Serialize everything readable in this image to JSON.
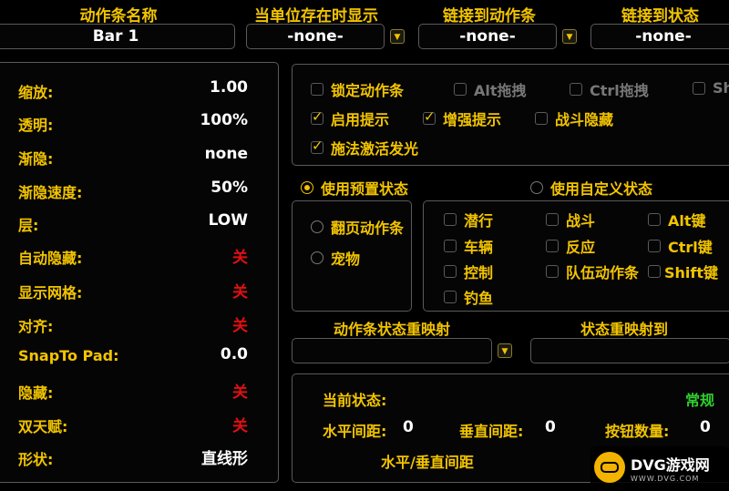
{
  "top": {
    "headers": {
      "bar_name": "动作条名称",
      "show_when_unit_exists": "当单位存在时显示",
      "link_to_bar": "链接到动作条",
      "link_to_state": "链接到状态"
    },
    "bar_name_value": "Bar 1",
    "show_when_unit_value": "-none-",
    "link_to_bar_value": "-none-",
    "link_to_state_value": "-none-"
  },
  "settings": [
    {
      "label": "缩放:",
      "value": "1.00",
      "color": "#ffffff"
    },
    {
      "label": "透明:",
      "value": "100%",
      "color": "#ffffff"
    },
    {
      "label": "渐隐:",
      "value": "none",
      "color": "#ffffff"
    },
    {
      "label": "渐隐速度:",
      "value": "50%",
      "color": "#ffffff"
    },
    {
      "label": "层:",
      "value": "LOW",
      "color": "#ffffff"
    },
    {
      "label": "自动隐藏:",
      "value": "关",
      "color": "#e01010"
    },
    {
      "label": "显示网格:",
      "value": "关",
      "color": "#e01010"
    },
    {
      "label": "对齐:",
      "value": "关",
      "color": "#e01010"
    },
    {
      "label": "SnapTo Pad:",
      "value": "0.0",
      "color": "#ffffff"
    },
    {
      "label": "隐藏:",
      "value": "关",
      "color": "#e01010"
    },
    {
      "label": "双天赋:",
      "value": "关",
      "color": "#e01010"
    },
    {
      "label": "形状:",
      "value": "直线形",
      "color": "#ffffff"
    }
  ],
  "options": {
    "lock_bar": "锁定动作条",
    "alt_drag": "Alt拖拽",
    "ctrl_drag": "Ctrl拖拽",
    "shift_drag": "Sh",
    "enable_tooltips": "启用提示",
    "enhanced_tooltips": "增强提示",
    "combat_hide": "战斗隐藏",
    "spell_glow": "施法激活发光"
  },
  "state_mode": {
    "preset": "使用预置状态",
    "custom": "使用自定义状态"
  },
  "preset_states": {
    "page": "翻页动作条",
    "pet": "宠物"
  },
  "state_checks": {
    "stealth": "潜行",
    "combat": "战斗",
    "alt_key": "Alt键",
    "vehicle": "车辆",
    "reaction": "反应",
    "ctrl_key": "Ctrl键",
    "possess": "控制",
    "group": "队伍动作条",
    "shift_key": "Shift键",
    "fishing": "钓鱼"
  },
  "remap": {
    "label": "动作条状态重映射",
    "to_label": "状态重映射到",
    "value": "",
    "to_value": ""
  },
  "status": {
    "current_state_label": "当前状态:",
    "current_state_value": "常规",
    "hpad_label": "水平间距:",
    "hpad_value": "0",
    "vpad_label": "垂直间距:",
    "vpad_value": "0",
    "btn_count_label": "按钮数量:",
    "btn_count_value": "0",
    "hv_pad_label": "水平/垂直间距"
  },
  "watermark": {
    "brand": "DVG游戏网",
    "url": "WWW.DVG.COM"
  }
}
